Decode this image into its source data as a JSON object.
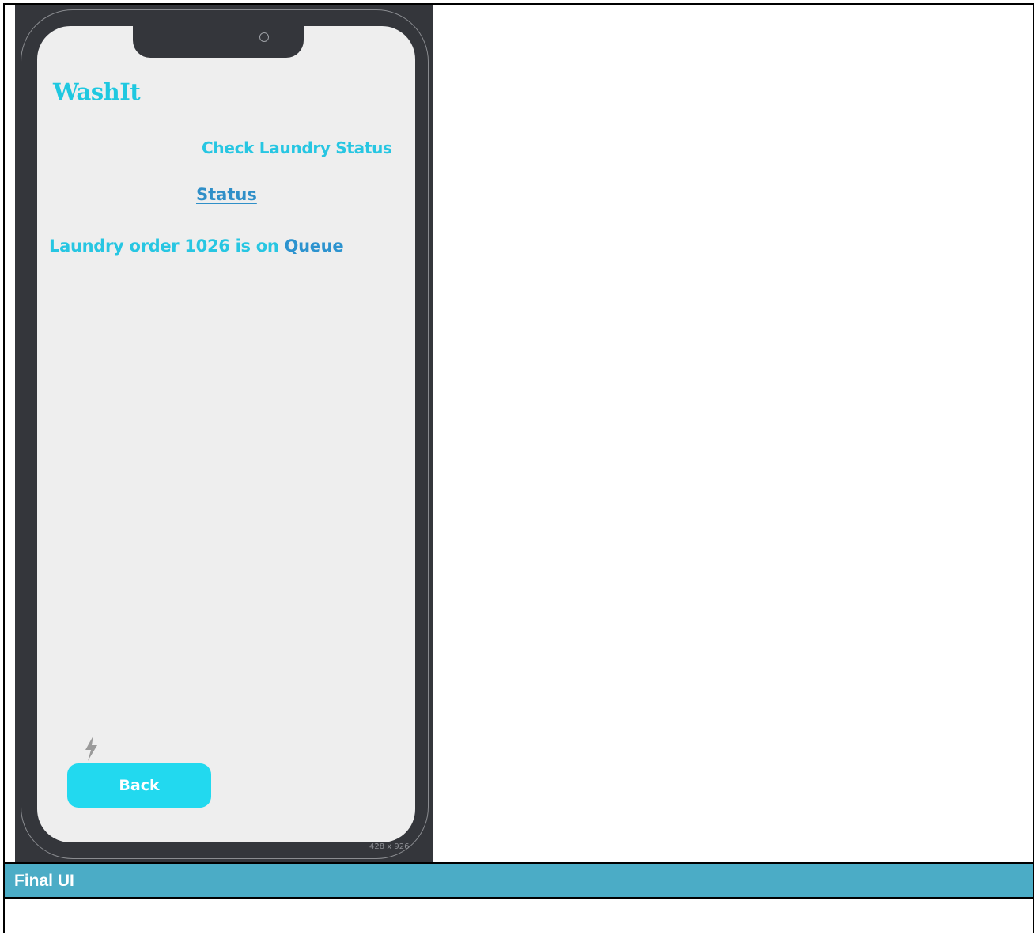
{
  "app": {
    "name": "WashIt"
  },
  "screen": {
    "heading": "Check Laundry Status",
    "status_link": "Status",
    "status_message_prefix": "Laundry order 1026 is on ",
    "status_value": "Queue",
    "back_label": "Back"
  },
  "mockup": {
    "size_label": "428 x 926"
  },
  "section": {
    "title": "Final UI"
  },
  "icons": {
    "flash": "lightning-bolt-icon"
  },
  "colors": {
    "accent": "#22d9ef",
    "text_cyan": "#27c6e2",
    "link_blue": "#2f8fc8",
    "frame": "#34363b",
    "screen_bg": "#eeeeee",
    "header_bg": "#4bacc6"
  }
}
